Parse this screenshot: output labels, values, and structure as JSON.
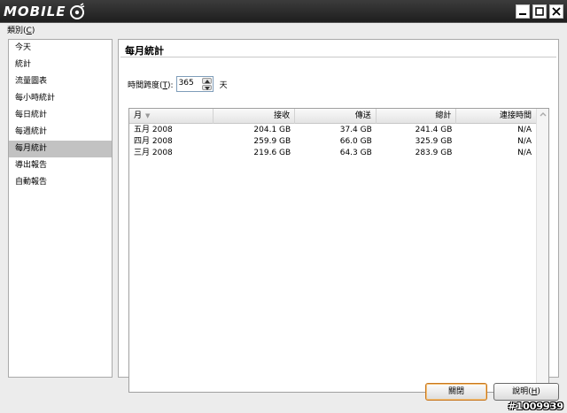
{
  "titlebar": {
    "app_title": "MOBILE"
  },
  "menu": {
    "category_label": "類別",
    "category_key": "C"
  },
  "sidebar": {
    "items": [
      {
        "label": "今天"
      },
      {
        "label": "統計"
      },
      {
        "label": "流量圖表"
      },
      {
        "label": "每小時統計"
      },
      {
        "label": "每日統計"
      },
      {
        "label": "每週統計"
      },
      {
        "label": "每月統計",
        "selected": true
      },
      {
        "label": "導出報告"
      },
      {
        "label": "自動報告"
      }
    ]
  },
  "main": {
    "title": "每月統計",
    "span": {
      "label": "時間跨度",
      "key": "T",
      "suffix": "):",
      "value": "365",
      "unit": "天"
    },
    "table": {
      "columns": [
        "月",
        "接收",
        "傳送",
        "總計",
        "連接時間"
      ],
      "rows": [
        [
          "五月 2008",
          "204.1 GB",
          "37.4 GB",
          "241.4 GB",
          "N/A"
        ],
        [
          "四月 2008",
          "259.9 GB",
          "66.0 GB",
          "325.9 GB",
          "N/A"
        ],
        [
          "三月 2008",
          "219.6 GB",
          "64.3 GB",
          "283.9 GB",
          "N/A"
        ]
      ]
    }
  },
  "buttons": {
    "close_label": "關閉",
    "help_label": "說明",
    "help_key": "H"
  },
  "watermark": "#1009939",
  "colors": {
    "selected_row": "#c2c2c2",
    "default_button_border": "#c8761c",
    "titlebar": "#2a2a2a"
  }
}
